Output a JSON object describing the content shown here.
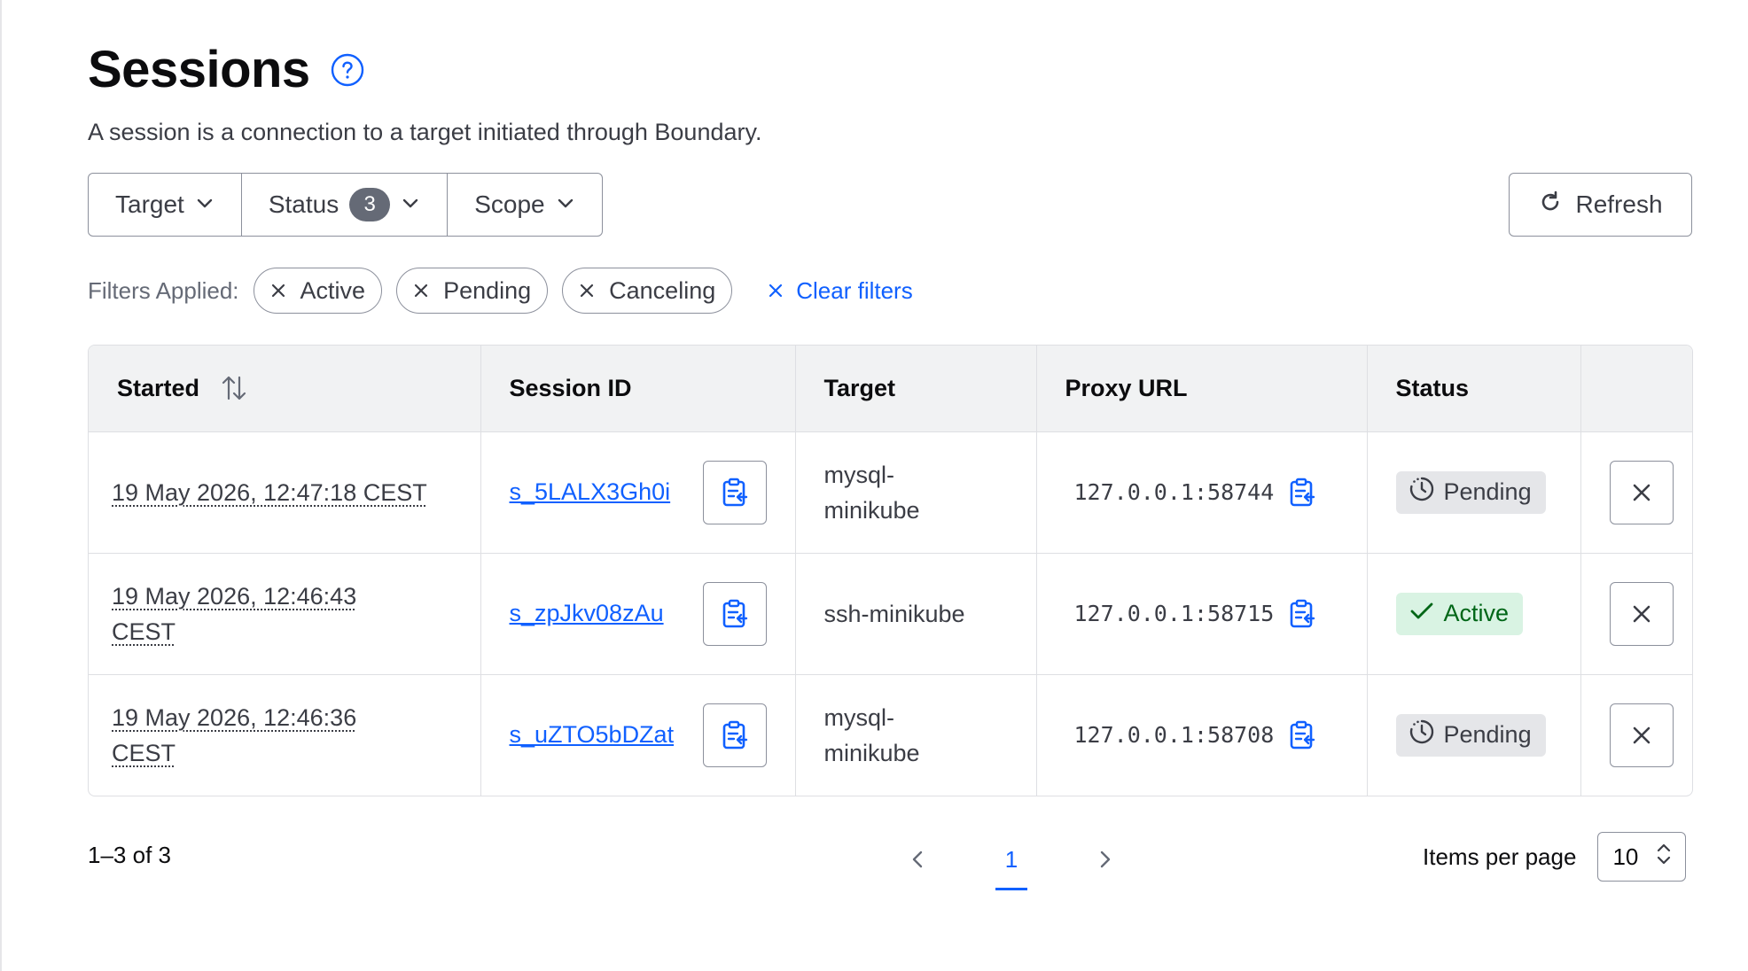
{
  "header": {
    "title": "Sessions",
    "description": "A session is a connection to a target initiated through Boundary."
  },
  "filters": {
    "target_label": "Target",
    "status_label": "Status",
    "status_count": "3",
    "scope_label": "Scope",
    "refresh_label": "Refresh",
    "applied_label": "Filters Applied:",
    "chips": [
      "Active",
      "Pending",
      "Canceling"
    ],
    "clear_label": "Clear filters"
  },
  "table": {
    "columns": [
      "Started",
      "Session ID",
      "Target",
      "Proxy URL",
      "Status",
      ""
    ],
    "rows": [
      {
        "started": "19 May 2026, 12:47:18 CEST",
        "session_id": "s_5LALX3Gh0i",
        "target": "mysql-minikube",
        "proxy_url": "127.0.0.1:58744",
        "status": "Pending"
      },
      {
        "started": "19 May 2026, 12:46:43 CEST",
        "session_id": "s_zpJkv08zAu",
        "target": "ssh-minikube",
        "proxy_url": "127.0.0.1:58715",
        "status": "Active"
      },
      {
        "started": "19 May 2026, 12:46:36 CEST",
        "session_id": "s_uZTO5bDZat",
        "target": "mysql-minikube",
        "proxy_url": "127.0.0.1:58708",
        "status": "Pending"
      }
    ]
  },
  "pagination": {
    "range": "1–3 of 3",
    "current_page": "1",
    "items_per_page_label": "Items per page",
    "items_per_page": "10"
  },
  "colors": {
    "link": "#1060ff",
    "active_bg": "#d9f3e3",
    "active_fg": "#006617",
    "pending_bg": "#e5e6e9"
  },
  "icons": {
    "help": "help-circle-icon",
    "chevron": "chevron-down-icon",
    "refresh": "refresh-icon",
    "close": "close-icon",
    "sort": "sort-arrows-icon",
    "copy": "clipboard-copy-icon",
    "pending": "clock-icon",
    "active": "check-icon"
  }
}
